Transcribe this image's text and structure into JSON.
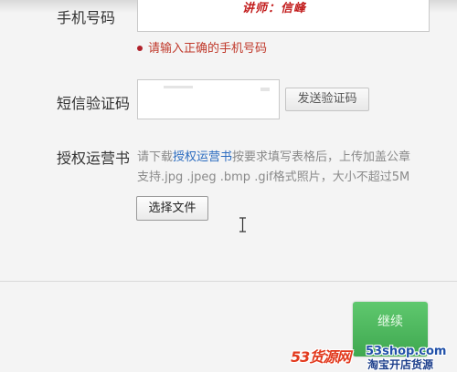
{
  "form": {
    "phone": {
      "label": "手机号码",
      "error": "请输入正确的手机号码"
    },
    "sms": {
      "label": "短信验证码",
      "send_button": "发送验证码"
    },
    "authorization": {
      "label": "授权运营书",
      "desc_prefix": "请下载",
      "desc_link": "授权运营书",
      "desc_suffix": "按要求填写表格后，上传加盖公章",
      "desc_line2": "支持.jpg .jpeg .bmp .gif格式照片，大小不超过5M",
      "file_button": "选择文件"
    }
  },
  "continue_button": "继续",
  "watermark": {
    "lecturer": "讲师：信峰",
    "brand_logo": "53货源网",
    "brand_site": "53shop.com",
    "brand_slogan": "淘宝开店货源"
  },
  "colors": {
    "error": "#c0392b",
    "link": "#2a6bbf",
    "continue": "#4cb55c",
    "brand_red": "#e23a1e",
    "brand_blue": "#2050a8"
  },
  "icons": {
    "error": "error-dot-icon",
    "cursor": "text-cursor-icon"
  }
}
